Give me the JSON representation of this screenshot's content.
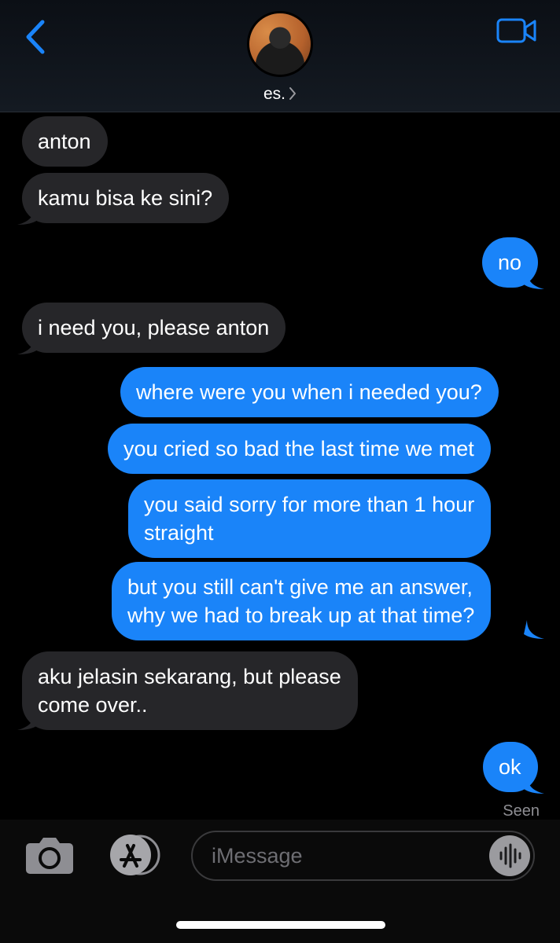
{
  "header": {
    "contact_name": "es.",
    "icons": {
      "back": "chevron-left-icon",
      "video": "video-camera-icon",
      "disclosure": "chevron-right-icon"
    },
    "accent_color": "#1a84f9"
  },
  "messages": [
    {
      "from": "them",
      "text": "anton"
    },
    {
      "from": "them",
      "text": "kamu bisa ke sini?"
    },
    {
      "from": "me",
      "text": "no"
    },
    {
      "from": "them",
      "text": "i need you, please anton"
    },
    {
      "from": "me",
      "text": "where were you when i needed you?"
    },
    {
      "from": "me",
      "text": "you cried so bad the last time we met"
    },
    {
      "from": "me",
      "text": "you said sorry for more than 1 hour\nstraight"
    },
    {
      "from": "me",
      "text": "but you still can't give me an answer,\nwhy we had to break up at that time?"
    },
    {
      "from": "them",
      "text": "aku jelasin sekarang, but please\ncome over.."
    },
    {
      "from": "me",
      "text": "ok"
    }
  ],
  "status": {
    "seen": "Seen"
  },
  "composer": {
    "placeholder": "iMessage",
    "icons": {
      "camera": "camera-icon",
      "apps": "app-store-icon",
      "audio": "audio-waveform-icon"
    }
  },
  "colors": {
    "incoming_bubble": "#262629",
    "outgoing_bubble": "#1a84f9",
    "background": "#000000"
  }
}
